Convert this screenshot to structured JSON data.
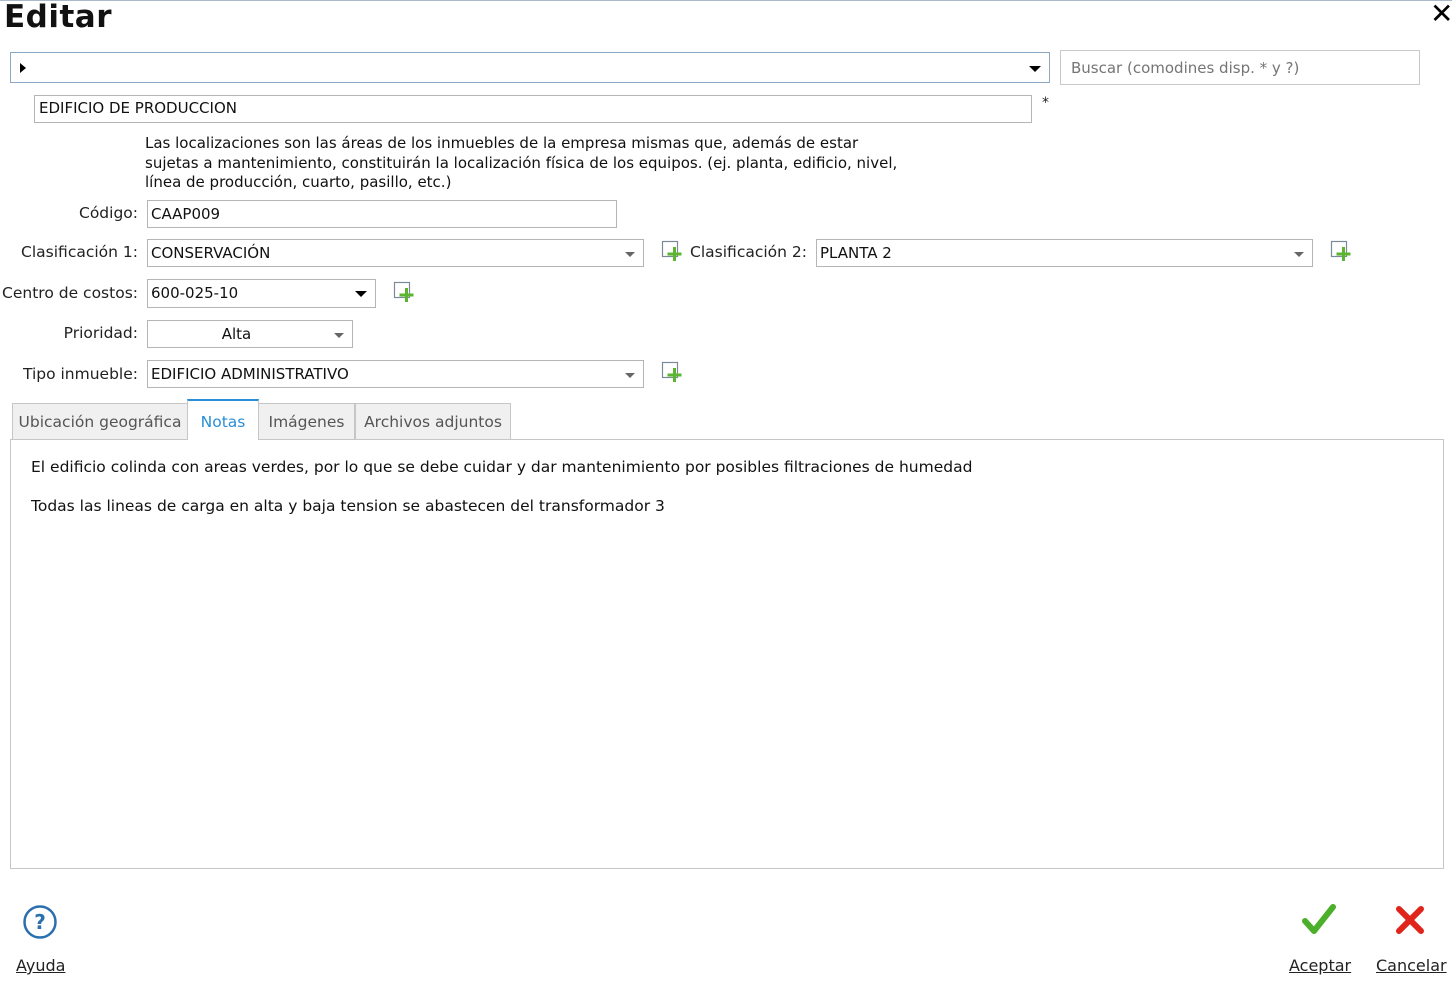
{
  "window": {
    "title": "Editar",
    "close_icon": "close-icon"
  },
  "navigator": {
    "value": ""
  },
  "search": {
    "placeholder": "Buscar (comodines disp. * y ?)"
  },
  "name": {
    "value": "EDIFICIO DE PRODUCCION",
    "required_mark": "*"
  },
  "description": "Las localizaciones son las áreas de los inmuebles de la empresa mismas que, además de estar sujetas a mantenimiento, constituirán la localización física de los equipos. (ej. planta, edificio, nivel, línea de producción, cuarto, pasillo, etc.)",
  "form": {
    "codigo": {
      "label": "Código:",
      "value": "CAAP009"
    },
    "clasificacion1": {
      "label": "Clasificación 1:",
      "value": "CONSERVACIÓN"
    },
    "clasificacion2": {
      "label": "Clasificación 2:",
      "value": "PLANTA 2"
    },
    "centro_costos": {
      "label": "Centro de costos:",
      "value": "600-025-10"
    },
    "prioridad": {
      "label": "Prioridad:",
      "value": "Alta"
    },
    "tipo_inmueble": {
      "label": "Tipo inmueble:",
      "value": "EDIFICIO ADMINISTRATIVO"
    }
  },
  "tabs": [
    {
      "label": "Ubicación geográfica",
      "active": false
    },
    {
      "label": "Notas",
      "active": true
    },
    {
      "label": "Imágenes",
      "active": false
    },
    {
      "label": "Archivos adjuntos",
      "active": false
    }
  ],
  "notes": [
    "El edificio colinda con areas verdes, por lo que se debe cuidar y dar mantenimiento por posibles filtraciones de humedad",
    "Todas las lineas de carga en alta y baja tension se abastecen del transformador 3"
  ],
  "footer": {
    "help_label": "Ayuda",
    "accept_label": "Aceptar",
    "cancel_label": "Cancelar"
  },
  "colors": {
    "accent": "#2a8fd6",
    "add_icon_green": "#5cb531",
    "accept_green": "#4caf2a",
    "cancel_red": "#e0241b",
    "help_blue": "#2a6fb0"
  }
}
